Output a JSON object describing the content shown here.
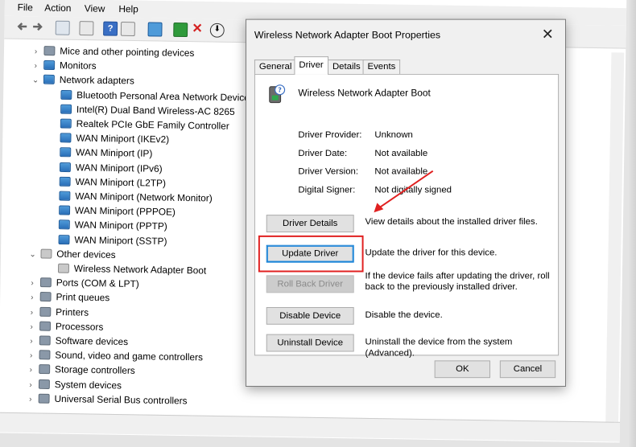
{
  "menu": {
    "file": "File",
    "action": "Action",
    "view": "View",
    "help": "Help"
  },
  "toolbar_icons": [
    "back-arrow-icon",
    "forward-arrow-icon",
    "properties-icon",
    "console-icon",
    "help-icon",
    "view-icon",
    "monitor-icon",
    "update-driver-icon",
    "uninstall-x-icon",
    "download-icon"
  ],
  "tree": [
    {
      "label": "Mice and other pointing devices",
      "expanded": false
    },
    {
      "label": "Monitors",
      "expanded": false
    },
    {
      "label": "Network adapters",
      "expanded": true
    },
    {
      "label": "Bluetooth Personal Area Network Device"
    },
    {
      "label": "Intel(R) Dual Band Wireless-AC 8265"
    },
    {
      "label": "Realtek PCIe GbE Family Controller"
    },
    {
      "label": "WAN Miniport (IKEv2)"
    },
    {
      "label": "WAN Miniport (IP)"
    },
    {
      "label": "WAN Miniport (IPv6)"
    },
    {
      "label": "WAN Miniport (L2TP)"
    },
    {
      "label": "WAN Miniport (Network Monitor)"
    },
    {
      "label": "WAN Miniport (PPPOE)"
    },
    {
      "label": "WAN Miniport (PPTP)"
    },
    {
      "label": "WAN Miniport (SSTP)"
    },
    {
      "label": "Other devices",
      "expanded": true
    },
    {
      "label": "Wireless Network Adapter Boot"
    },
    {
      "label": "Ports (COM & LPT)",
      "expanded": false
    },
    {
      "label": "Print queues",
      "expanded": false
    },
    {
      "label": "Printers",
      "expanded": false
    },
    {
      "label": "Processors",
      "expanded": false
    },
    {
      "label": "Software devices",
      "expanded": false
    },
    {
      "label": "Sound, video and game controllers",
      "expanded": false
    },
    {
      "label": "Storage controllers",
      "expanded": false
    },
    {
      "label": "System devices",
      "expanded": false
    },
    {
      "label": "Universal Serial Bus controllers",
      "expanded": false
    }
  ],
  "dialog": {
    "title": "Wireless Network Adapter Boot Properties",
    "close": "✕",
    "tabs": [
      "General",
      "Driver",
      "Details",
      "Events"
    ],
    "active_tab": "Driver",
    "device_name": "Wireless Network Adapter Boot",
    "fields": [
      {
        "label": "Driver Provider:",
        "value": "Unknown"
      },
      {
        "label": "Driver Date:",
        "value": "Not available"
      },
      {
        "label": "Driver Version:",
        "value": "Not available"
      },
      {
        "label": "Digital Signer:",
        "value": "Not digitally signed"
      }
    ],
    "actions": [
      {
        "button": "Driver Details",
        "description": "View details about the installed driver files.",
        "enabled": true
      },
      {
        "button": "Update Driver",
        "description": "Update the driver for this device.",
        "enabled": true,
        "highlighted": true
      },
      {
        "button": "Roll Back Driver",
        "description": "If the device fails after updating the driver, roll back to the previously installed driver.",
        "enabled": false
      },
      {
        "button": "Disable Device",
        "description": "Disable the device.",
        "enabled": true
      },
      {
        "button": "Uninstall Device",
        "description": "Uninstall the device from the system (Advanced).",
        "enabled": true
      }
    ],
    "ok": "OK",
    "cancel": "Cancel"
  },
  "colors": {
    "highlight_box": "#e02020",
    "arrow": "#e02020",
    "primary_border": "#0078d7"
  }
}
